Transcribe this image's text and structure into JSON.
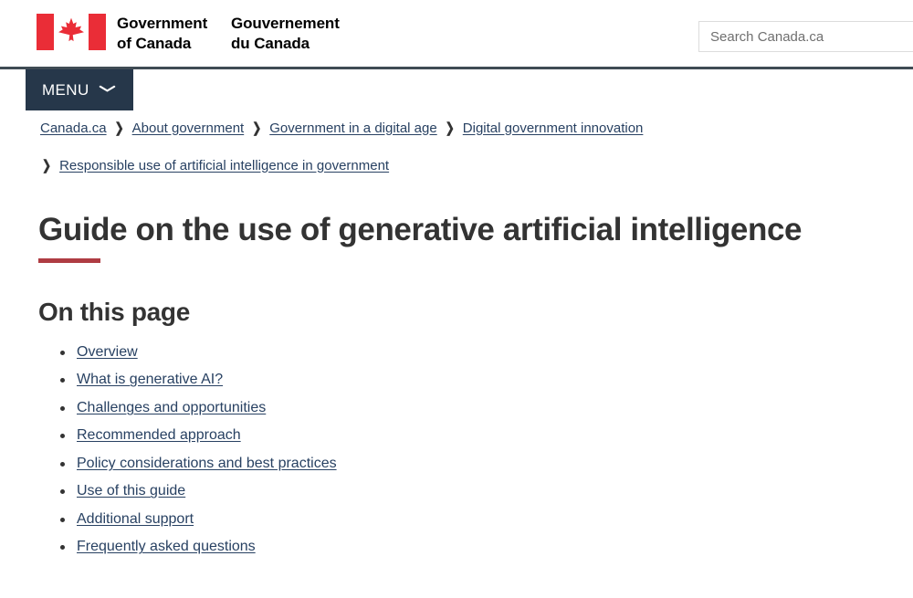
{
  "header": {
    "flag_color": "#ea2d37",
    "wordmark_en_line1": "Government",
    "wordmark_en_line2": "of Canada",
    "wordmark_fr_line1": "Gouvernement",
    "wordmark_fr_line2": "du Canada",
    "search_placeholder": "Search Canada.ca",
    "search_value": "",
    "rule_color": "#3f4b54"
  },
  "menu": {
    "label": "MENU",
    "chevron": "❯",
    "background": "#26374a"
  },
  "breadcrumb": {
    "separator": "❯",
    "row1": [
      {
        "label": "Canada.ca"
      },
      {
        "label": "About government"
      },
      {
        "label": "Government in a digital age"
      },
      {
        "label": "Digital government innovation"
      }
    ],
    "row2": [
      {
        "label": "Responsible use of artificial intelligence in government"
      }
    ]
  },
  "main": {
    "page_title": "Guide on the use of generative artificial intelligence",
    "title_rule_color": "#af3c43",
    "section_title": "On this page",
    "toc": [
      {
        "label": "Overview"
      },
      {
        "label": "What is generative AI?"
      },
      {
        "label": "Challenges and opportunities"
      },
      {
        "label": "Recommended approach"
      },
      {
        "label": "Policy considerations and best practices"
      },
      {
        "label": "Use of this guide"
      },
      {
        "label": "Additional support"
      },
      {
        "label": "Frequently asked questions"
      }
    ]
  },
  "colors": {
    "link": "#284162",
    "text": "#333333",
    "accent_red": "#af3c43",
    "navy": "#26374a"
  }
}
